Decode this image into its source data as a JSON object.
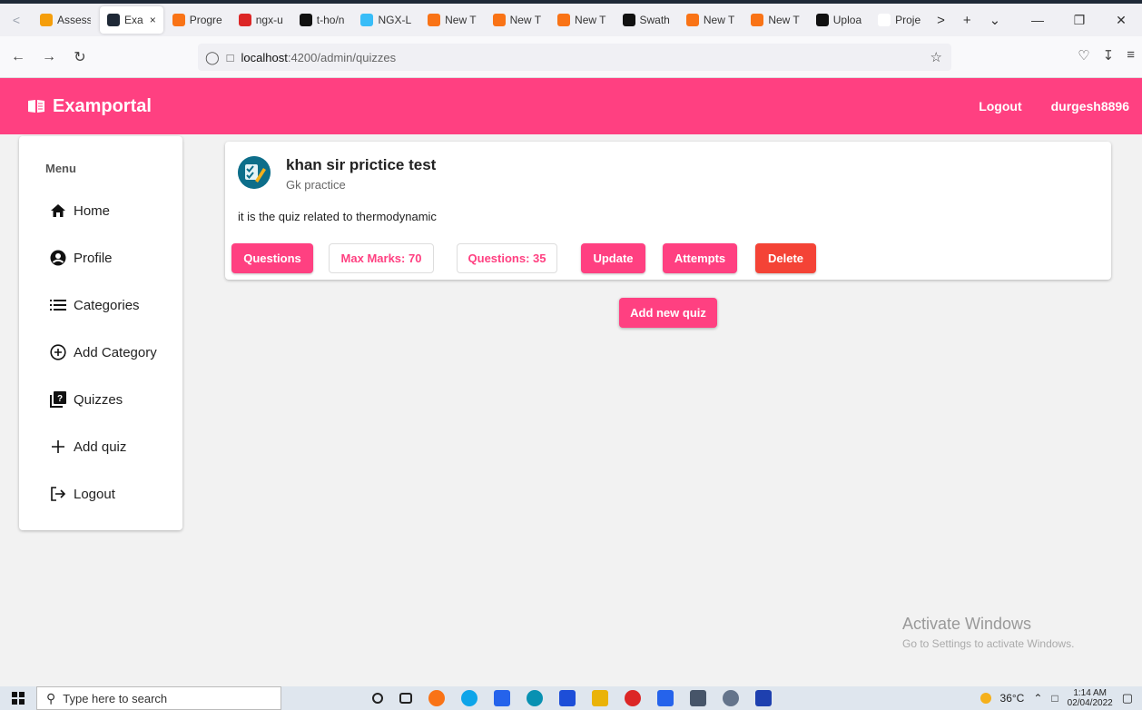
{
  "browser": {
    "tabs": [
      {
        "label": "Assess",
        "color": "#f59e0b"
      },
      {
        "label": "Exa",
        "color": "#1f2937",
        "active": true
      },
      {
        "label": "Progre",
        "color": "#f97316"
      },
      {
        "label": "ngx-u",
        "color": "#dc2626"
      },
      {
        "label": "t-ho/n",
        "color": "#111111"
      },
      {
        "label": "NGX-L",
        "color": "#38bdf8"
      },
      {
        "label": "New T",
        "color": "#f97316"
      },
      {
        "label": "New T",
        "color": "#f97316"
      },
      {
        "label": "New T",
        "color": "#f97316"
      },
      {
        "label": "Swath",
        "color": "#111111"
      },
      {
        "label": "New T",
        "color": "#f97316"
      },
      {
        "label": "New T",
        "color": "#f97316"
      },
      {
        "label": "Uploa",
        "color": "#111111"
      },
      {
        "label": "Proje",
        "color": "#ffffff"
      }
    ],
    "close_tab": "×",
    "url_host": "localhost",
    "url_path": ":4200/admin/quizzes"
  },
  "navbar": {
    "brand": "Examportal",
    "logout": "Logout",
    "username": "durgesh8896"
  },
  "sidebar": {
    "heading": "Menu",
    "items": [
      {
        "label": "Home",
        "icon": "home-icon"
      },
      {
        "label": "Profile",
        "icon": "account-circle-icon"
      },
      {
        "label": "Categories",
        "icon": "list-icon"
      },
      {
        "label": "Add Category",
        "icon": "add-circle-icon"
      },
      {
        "label": "Quizzes",
        "icon": "quiz-icon"
      },
      {
        "label": "Add quiz",
        "icon": "add-icon"
      },
      {
        "label": "Logout",
        "icon": "logout-icon"
      }
    ]
  },
  "quiz": {
    "title": "khan sir pri​ctice test",
    "category": "Gk practice",
    "description": "it is the quiz related to thermodynamic",
    "questions_button": "Questions",
    "max_marks": "Max Marks: 70",
    "question_count": "Questions: 35",
    "update_button": "Update",
    "attempts_button": "Attempts",
    "delete_button": "Delete"
  },
  "add_quiz_button": "Add new quiz",
  "watermark": {
    "line1": "Activate Windows",
    "line2": "Go to Settings to activate Windows."
  },
  "taskbar": {
    "search_placeholder": "Type here to search",
    "temperature": "36°C",
    "time": "1:14 AM",
    "date": "02/04/2022"
  },
  "colors": {
    "accent": "#ff4081",
    "danger": "#f44336"
  }
}
